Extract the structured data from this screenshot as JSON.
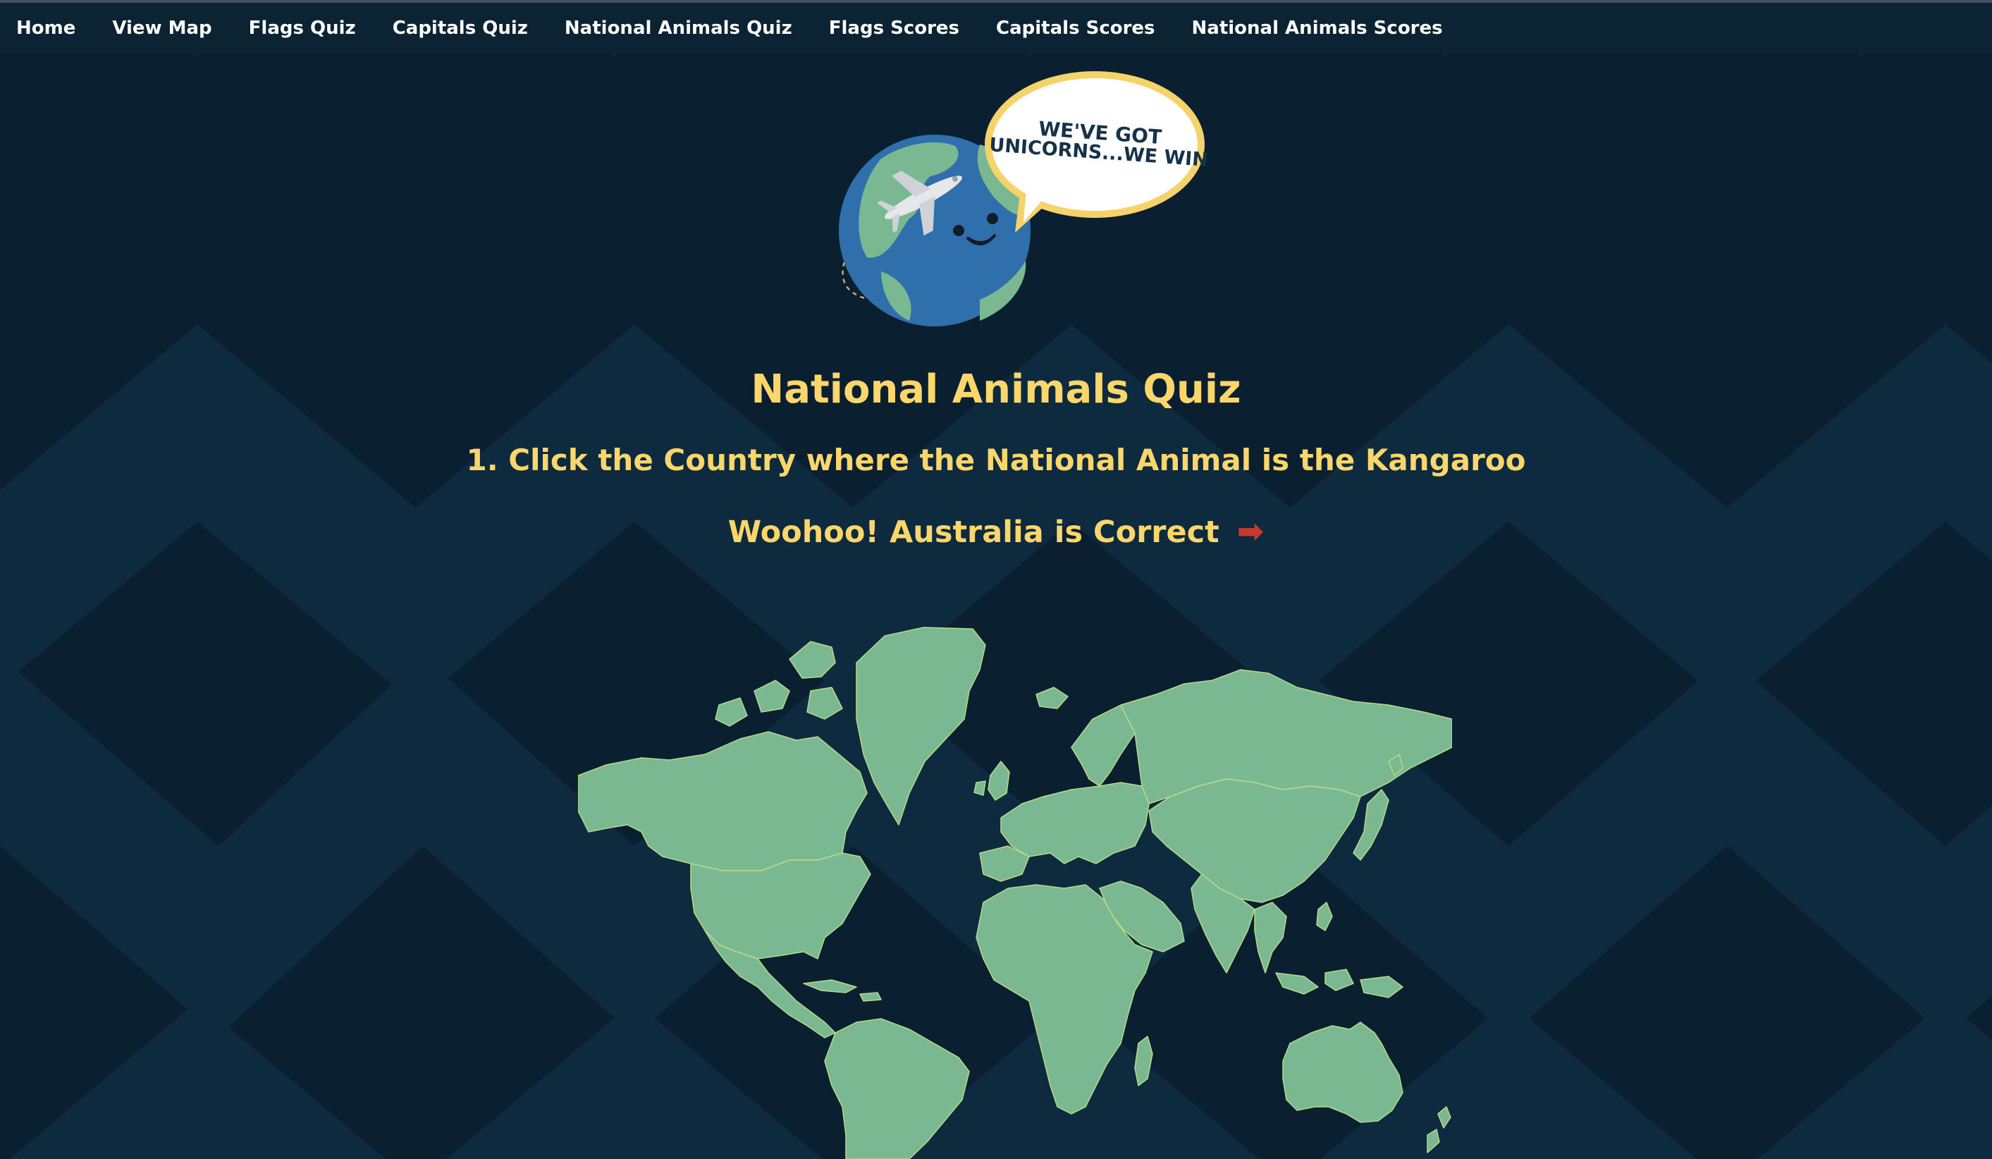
{
  "nav": {
    "items": [
      {
        "label": "Home"
      },
      {
        "label": "View Map"
      },
      {
        "label": "Flags Quiz"
      },
      {
        "label": "Capitals Quiz"
      },
      {
        "label": "National Animals Quiz"
      },
      {
        "label": "Flags Scores"
      },
      {
        "label": "Capitals Scores"
      },
      {
        "label": "National Animals Scores"
      }
    ]
  },
  "logo": {
    "bubble_line1": "WE'VE GOT",
    "bubble_line2": "UNICORNS...WE WIN"
  },
  "page": {
    "title": "National Animals Quiz",
    "question": "1. Click the Country where the National Animal is the Kangaroo",
    "feedback": "Woohoo! Australia is Correct",
    "next_icon": "➡"
  },
  "colors": {
    "background": "#0a1f2f",
    "nav_background": "#0c2333",
    "accent_yellow": "#fbd66a",
    "map_land": "#79b891",
    "arrow_red": "#c43a2c"
  }
}
